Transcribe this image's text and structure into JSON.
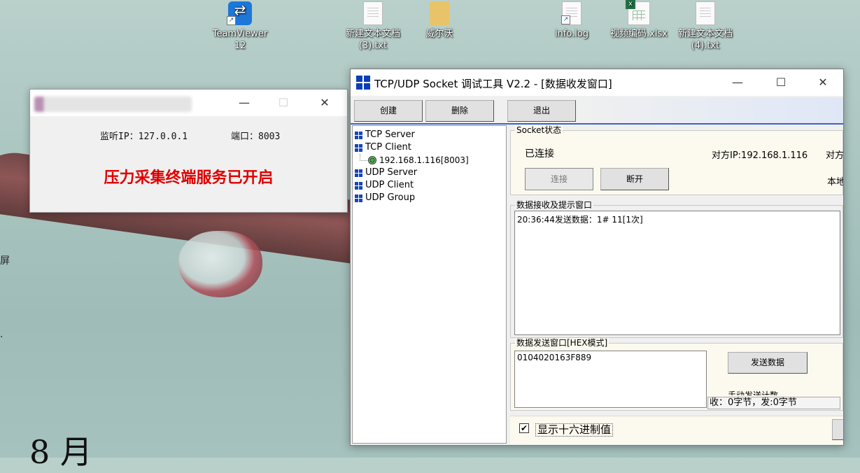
{
  "desktop": {
    "icons": [
      {
        "label": "TeamViewer\n12",
        "type": "teamviewer"
      },
      {
        "label": "新建文本文档\n(3).txt",
        "type": "txt"
      },
      {
        "label": "威尔沃",
        "type": "folder"
      },
      {
        "label": "info.log",
        "type": "txt"
      },
      {
        "label": "视频编码.xlsx",
        "type": "xlsx"
      },
      {
        "label": "新建文本文档\n(4).txt",
        "type": "txt"
      }
    ],
    "edge_text_1": "屏",
    "edge_text_2": ".",
    "date_fragment": "8 月"
  },
  "server_window": {
    "listen_ip": "监听IP：127.0.0.1",
    "port": "端口：8003",
    "status": "压力采集终端服务已开启",
    "status_color": "#e00000",
    "controls": {
      "minimize": "—",
      "maximize": "☐",
      "close": "✕"
    }
  },
  "tool_window": {
    "title": "TCP/UDP Socket 调试工具 V2.2 - [数据收发窗口]",
    "controls": {
      "minimize": "—",
      "maximize": "☐",
      "close": "✕"
    },
    "toolbar": {
      "create": "创建",
      "delete": "删除",
      "exit": "退出"
    },
    "tree": {
      "tcp_server": "TCP Server",
      "tcp_client": "TCP Client",
      "connection": "192.168.1.116[8003]",
      "udp_server": "UDP Server",
      "udp_client": "UDP Client",
      "udp_group": "UDP Group"
    },
    "socket_state": {
      "title": "Socket状态",
      "state": "已连接",
      "peer_ip": "对方IP:192.168.1.116",
      "peer_cut": "对方",
      "local_cut": "本地",
      "connect": "连接",
      "disconnect": "断开"
    },
    "recv": {
      "title": "数据接收及提示窗口",
      "log": "20:36:44发送数据：1# 11[1次]"
    },
    "send": {
      "title": "数据发送窗口[HEX模式]",
      "content": "0104020163F889",
      "send_button": "发送数据",
      "clipped_text": "手动发送计数",
      "counter": "收：0字节，发:0字节"
    },
    "options": {
      "hex_label": "显示十六进制值",
      "hex_checked": "✔"
    },
    "accent_color": "#3b63c9"
  }
}
